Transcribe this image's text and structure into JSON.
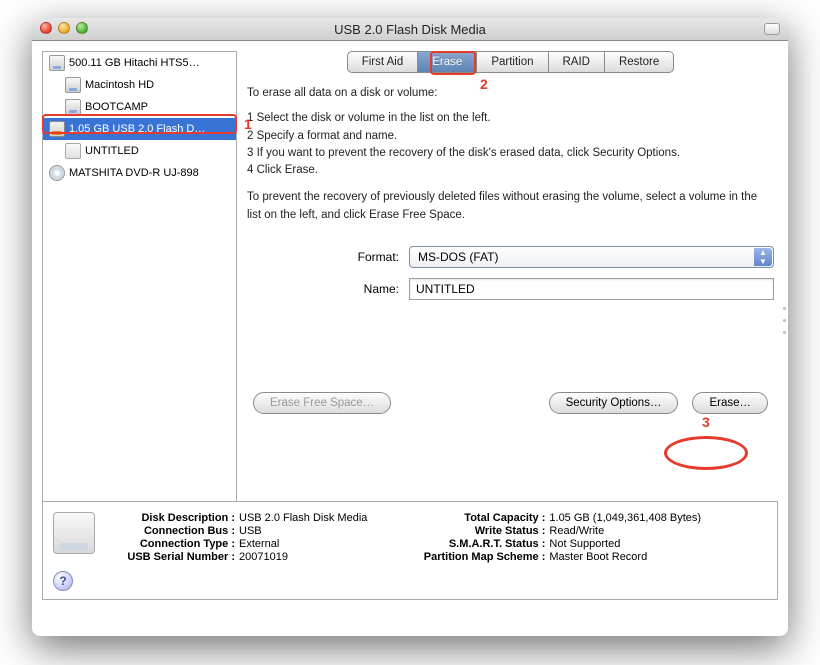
{
  "window": {
    "title": "USB 2.0 Flash Disk Media"
  },
  "sidebar": {
    "items": [
      {
        "label": "500.11 GB Hitachi HTS5…",
        "type": "hdd"
      },
      {
        "label": "Macintosh HD",
        "type": "vol"
      },
      {
        "label": "BOOTCAMP",
        "type": "vol"
      },
      {
        "label": "1.05 GB USB 2.0 Flash D…",
        "type": "usb",
        "selected": true
      },
      {
        "label": "UNTITLED",
        "type": "vol"
      },
      {
        "label": "MATSHITA DVD-R UJ-898",
        "type": "dvd"
      }
    ]
  },
  "tabs": {
    "items": [
      "First Aid",
      "Erase",
      "Partition",
      "RAID",
      "Restore"
    ],
    "active": "Erase"
  },
  "instructions": {
    "intro": "To erase all data on a disk or volume:",
    "step1": "1  Select the disk or volume in the list on the left.",
    "step2": "2  Specify a format and name.",
    "step3": "3  If you want to prevent the recovery of the disk's erased data, click Security Options.",
    "step4": "4  Click Erase.",
    "note": "To prevent the recovery of previously deleted files without erasing the volume, select a volume in the list on the left, and click Erase Free Space."
  },
  "form": {
    "format_label": "Format:",
    "format_value": "MS-DOS (FAT)",
    "name_label": "Name:",
    "name_value": "UNTITLED"
  },
  "buttons": {
    "erase_free": "Erase Free Space…",
    "security": "Security Options…",
    "erase": "Erase…"
  },
  "footer": {
    "left": {
      "k1": "Disk Description :",
      "v1": "USB 2.0 Flash Disk Media",
      "k2": "Connection Bus :",
      "v2": "USB",
      "k3": "Connection Type :",
      "v3": "External",
      "k4": "USB Serial Number :",
      "v4": "20071019"
    },
    "right": {
      "k1": "Total Capacity :",
      "v1": "1.05 GB (1,049,361,408 Bytes)",
      "k2": "Write Status :",
      "v2": "Read/Write",
      "k3": "S.M.A.R.T. Status :",
      "v3": "Not Supported",
      "k4": "Partition Map Scheme :",
      "v4": "Master Boot Record"
    }
  },
  "annotations": {
    "a1": "1",
    "a2": "2",
    "a3": "3"
  }
}
